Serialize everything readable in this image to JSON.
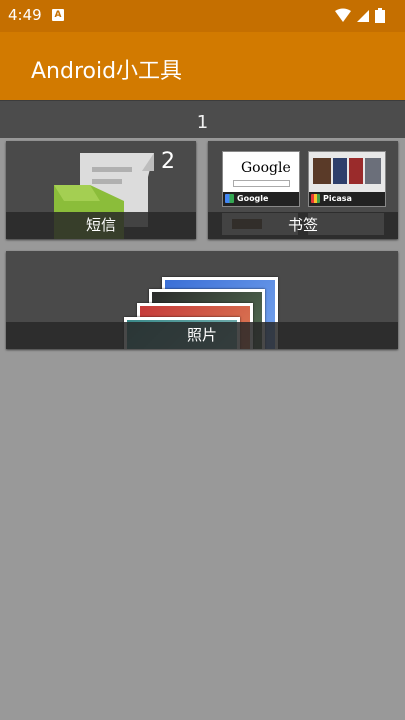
{
  "status_bar": {
    "time": "4:49",
    "notification": "A",
    "icons": [
      "wifi-icon",
      "cell-signal-icon",
      "battery-icon"
    ]
  },
  "app_bar": {
    "title": "Android小工具"
  },
  "page": {
    "number": "1"
  },
  "widgets": {
    "sms": {
      "label": "短信",
      "count": "2"
    },
    "bookmarks": {
      "label": "书签",
      "thumb1": {
        "logo": "Google",
        "caption": "Google"
      },
      "thumb2": {
        "caption": "Picasa"
      }
    },
    "photos": {
      "label": "照片"
    }
  },
  "colors": {
    "status_bar": "#c56f00",
    "app_bar": "#d27a00",
    "background": "#999999",
    "widget": "#4a4a4a"
  }
}
